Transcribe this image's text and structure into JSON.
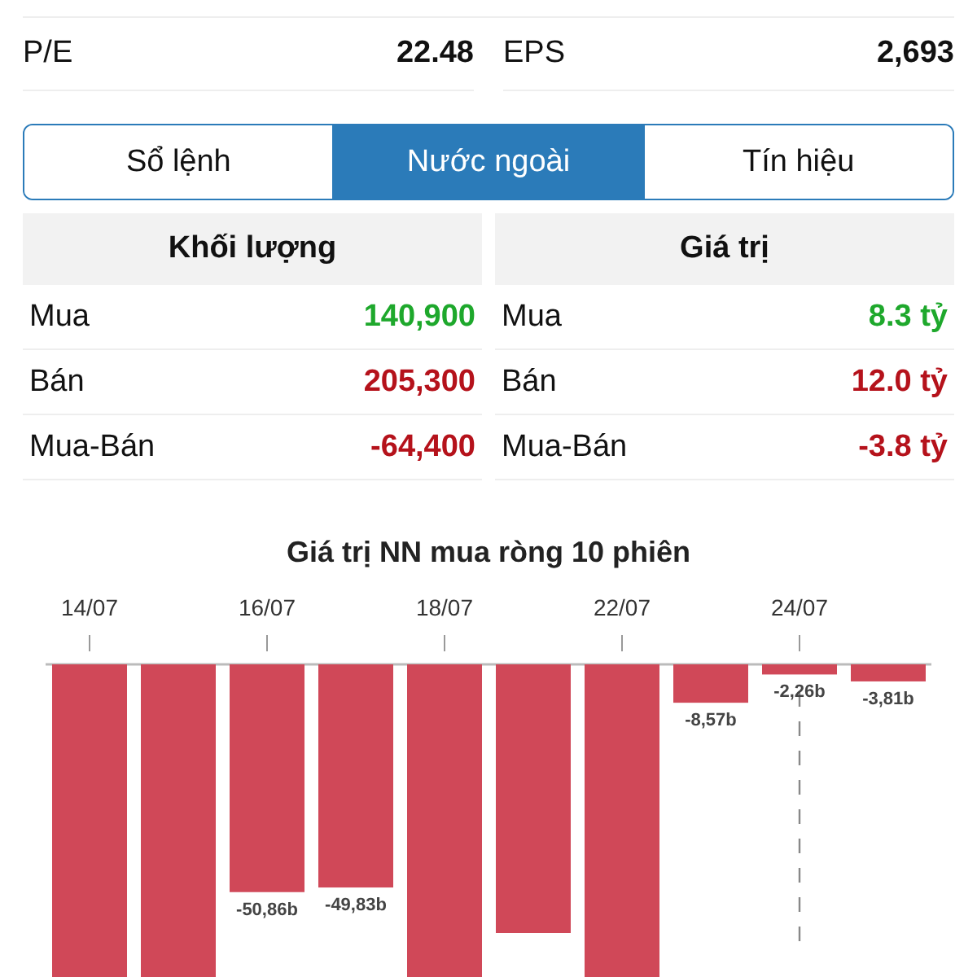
{
  "info_rows": [
    {
      "label": "P/E",
      "value": "22.48"
    },
    {
      "label": "EPS",
      "value": "2,693"
    }
  ],
  "tabs": [
    {
      "label": "Sổ lệnh",
      "selected": false
    },
    {
      "label": "Nước ngoài",
      "selected": true
    },
    {
      "label": "Tín hiệu",
      "selected": false
    }
  ],
  "foreign": [
    {
      "header": "Khối lượng",
      "rows": [
        {
          "label": "Mua",
          "value": "140,900",
          "color": "#1ea82c"
        },
        {
          "label": "Bán",
          "value": "205,300",
          "color": "#b5121b"
        },
        {
          "label": "Mua-Bán",
          "value": "-64,400",
          "color": "#b5121b"
        }
      ]
    },
    {
      "header": "Giá trị",
      "rows": [
        {
          "label": "Mua",
          "value": "8.3 tỷ",
          "color": "#1ea82c"
        },
        {
          "label": "Bán",
          "value": "12.0 tỷ",
          "color": "#b5121b"
        },
        {
          "label": "Mua-Bán",
          "value": "-3.8 tỷ",
          "color": "#b5121b"
        }
      ]
    }
  ],
  "chart": {
    "chart_data": {
      "type": "bar",
      "title": "Giá trị NN mua ròng 10 phiên",
      "categories": [
        "14/07",
        null,
        "16/07",
        null,
        "18/07",
        null,
        "22/07",
        null,
        "24/07",
        null
      ],
      "values": [
        -70,
        -70,
        -50.86,
        -49.83,
        -70,
        -60,
        -70,
        -8.57,
        -2.26,
        -3.81
      ],
      "value_labels": [
        null,
        null,
        "-50,86b",
        "-49,83b",
        null,
        null,
        null,
        "-8,57b",
        "-2,26b",
        "-3,81b"
      ],
      "annotations": [
        {
          "x": "24/07"
        }
      ]
    }
  }
}
